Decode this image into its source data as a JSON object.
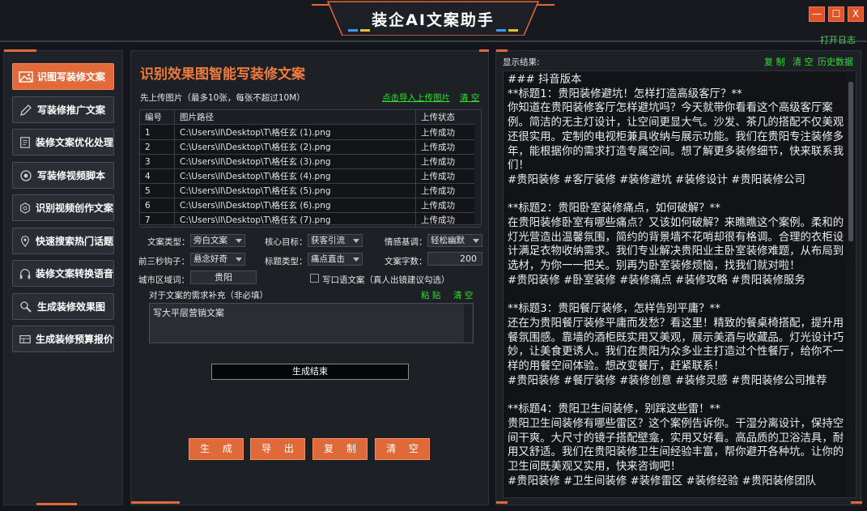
{
  "window": {
    "title": "装企AI文案助手",
    "open_log": "打开日志",
    "controls": [
      "—",
      "☐",
      "X"
    ]
  },
  "sidebar": {
    "items": [
      {
        "label": "识图写装修文案",
        "icon": "image-icon",
        "active": true
      },
      {
        "label": "写装修推广文案",
        "icon": "pen-icon",
        "active": false
      },
      {
        "label": "装修文案优化处理",
        "icon": "document-icon",
        "active": false
      },
      {
        "label": "写装修视频脚本",
        "icon": "camera-icon",
        "active": false
      },
      {
        "label": "识别视频创作文案",
        "icon": "video-settings-icon",
        "active": false
      },
      {
        "label": "快速搜索热门话题",
        "icon": "location-search-icon",
        "active": false
      },
      {
        "label": "装修文案转换语音",
        "icon": "headphones-icon",
        "active": false
      },
      {
        "label": "生成装修效果图",
        "icon": "brush-icon",
        "active": false
      },
      {
        "label": "生成装修预算报价",
        "icon": "calculator-icon",
        "active": false
      }
    ]
  },
  "main": {
    "title": "识别效果图智能写装修文案",
    "upload_hint": "先上传图片（最多10张，每张不超过10M）",
    "import_link": "点击导入上传图片",
    "clear_link": "清 空",
    "table": {
      "headers": [
        "编号",
        "图片路径",
        "上传状态"
      ],
      "rows": [
        [
          "1",
          "C:\\Users\\ll\\Desktop\\T\\格任玄 (1).png",
          "上传成功"
        ],
        [
          "2",
          "C:\\Users\\ll\\Desktop\\T\\格任玄 (2).png",
          "上传成功"
        ],
        [
          "3",
          "C:\\Users\\ll\\Desktop\\T\\格任玄 (3).png",
          "上传成功"
        ],
        [
          "4",
          "C:\\Users\\ll\\Desktop\\T\\格任玄 (4).png",
          "上传成功"
        ],
        [
          "5",
          "C:\\Users\\ll\\Desktop\\T\\格任玄 (5).png",
          "上传成功"
        ],
        [
          "6",
          "C:\\Users\\ll\\Desktop\\T\\格任玄 (6).png",
          "上传成功"
        ],
        [
          "7",
          "C:\\Users\\ll\\Desktop\\T\\格任玄 (7).png",
          "上传成功"
        ]
      ]
    },
    "form": {
      "copy_type_label": "文案类型：",
      "copy_type_value": "旁白文案",
      "core_goal_label": "核心目标：",
      "core_goal_value": "获客引流",
      "tone_label": "情感基调：",
      "tone_value": "轻松幽默",
      "hook_label": "前三秒钩子：",
      "hook_value": "悬念好奇",
      "title_type_label": "标题类型：",
      "title_type_value": "痛点直击",
      "word_count_label": "文案字数：",
      "word_count_value": "200",
      "city_label": "城市区域词：",
      "city_value": "贵阳",
      "oral_checkbox_label": "写口语文案（真人出镜建议勾选）",
      "supplement_label": "对于文案的需求补充（非必填）",
      "paste_link": "粘 贴",
      "clear_link": "清 空",
      "supplement_value": "写大平层营销文案"
    },
    "status": "生成结束",
    "buttons": {
      "generate": "生 成",
      "export": "导 出",
      "copy": "复 制",
      "clear": "清 空"
    }
  },
  "result": {
    "label": "显示结果:",
    "copy": "复 制",
    "clear": "清 空",
    "history": "历史数据",
    "text": "### 抖音版本\n**标题1：贵阳装修避坑！怎样打造高级客厅？**\n你知道在贵阳装修客厅怎样避坑吗？今天就带你看看这个高级客厅案例。简洁的无主灯设计，让空间更显大气。沙发、茶几的搭配不仅美观还很实用。定制的电视柜兼具收纳与展示功能。我们在贵阳专注装修多年，能根据你的需求打造专属空间。想了解更多装修细节，快来联系我们！\n#贵阳装修 #客厅装修 #装修避坑 #装修设计 #贵阳装修公司\n\n**标题2：贵阳卧室装修痛点，如何破解？**\n在贵阳装修卧室有哪些痛点？又该如何破解？来瞧瞧这个案例。柔和的灯光营造出温馨氛围，简约的背景墙不花哨却很有格调。合理的衣柜设计满足衣物收纳需求。我们专业解决贵阳业主卧室装修难题，从布局到选材，为你一一把关。别再为卧室装修烦恼，找我们就对啦！\n#贵阳装修 #卧室装修 #装修痛点 #装修攻略 #贵阳装修服务\n\n**标题3：贵阳餐厅装修，怎样告别平庸？**\n还在为贵阳餐厅装修平庸而发愁？看这里！精致的餐桌椅搭配，提升用餐氛围感。靠墙的酒柜既实用又美观，展示美酒与收藏品。灯光设计巧妙，让美食更诱人。我们在贵阳为众多业主打造过个性餐厅，给你不一样的用餐空间体验。想改变餐厅，赶紧联系！\n#贵阳装修 #餐厅装修 #装修创意 #装修灵感 #贵阳装修公司推荐\n\n**标题4：贵阳卫生间装修，别踩这些雷！**\n贵阳卫生间装修有哪些雷区？这个案例告诉你。干湿分离设计，保持空间干爽。大尺寸的镜子搭配壁龛，实用又好看。高品质的卫浴洁具，耐用又舒适。我们在贵阳装修卫生间经验丰富，帮你避开各种坑。让你的卫生间既美观又实用，快来咨询吧！\n#贵阳装修 #卫生间装修 #装修雷区 #装修经验 #贵阳装修团队"
  },
  "colors": {
    "accent": "#e2693a",
    "link": "#2fe02f",
    "background": "#14161b",
    "panel": "#1d2025"
  }
}
